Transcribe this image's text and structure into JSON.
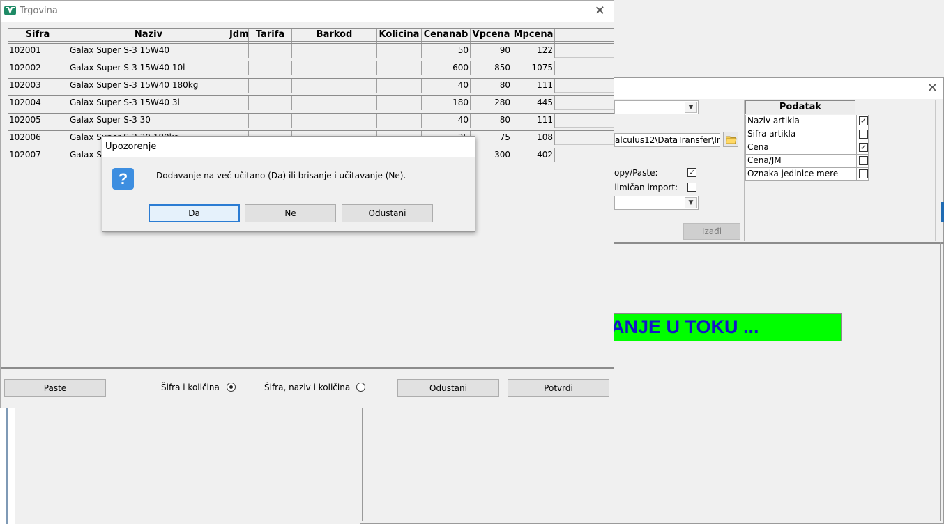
{
  "bg_window": {
    "path_value": "alculus12\\DataTransfer\\Im",
    "option_copy_paste_label": "opy/Paste:",
    "option_copy_paste_checked": true,
    "option_partial_import_label": "elimičan import:",
    "option_partial_import_checked": false,
    "exit_label": "Izađi",
    "podatak_header": "Podatak",
    "podatak_rows": [
      {
        "label": "Naziv artikla",
        "checked": true
      },
      {
        "label": "Sifra artikla",
        "checked": false
      },
      {
        "label": "Cena",
        "checked": true
      },
      {
        "label": "Cena/JM",
        "checked": false
      },
      {
        "label": "Oznaka jedinice mere",
        "checked": false
      }
    ],
    "progress_text": "ANJE U TOKU ...",
    "progress_color": "#00ff00",
    "progress_text_color": "#1515c8"
  },
  "main_window": {
    "title": "Trgovina",
    "columns": [
      "Sifra",
      "Naziv",
      "Jdm",
      "Tarifa",
      "Barkod",
      "Kolicina",
      "Cenanab",
      "Vpcena",
      "Mpcena"
    ],
    "rows": [
      [
        "102001",
        "Galax Super S-3 15W40",
        "",
        "",
        "",
        "",
        "50",
        "90",
        "122"
      ],
      [
        "102002",
        "Galax Super S-3 15W40 10l",
        "",
        "",
        "",
        "",
        "600",
        "850",
        "1075"
      ],
      [
        "102003",
        "Galax Super S-3 15W40 180kg",
        "",
        "",
        "",
        "",
        "40",
        "80",
        "111"
      ],
      [
        "102004",
        "Galax Super S-3 15W40 3l",
        "",
        "",
        "",
        "",
        "180",
        "280",
        "445"
      ],
      [
        "102005",
        "Galax Super S-3 30",
        "",
        "",
        "",
        "",
        "40",
        "80",
        "111"
      ],
      [
        "102006",
        "Galax Super S-3 30 180kg",
        "",
        "",
        "",
        "",
        "35",
        "75",
        "108"
      ],
      [
        "102007",
        "Galax Super S-3 30 5l",
        "",
        "",
        "",
        "",
        "200",
        "300",
        "402"
      ]
    ],
    "paste_label": "Paste",
    "radio_1_label": "Šifra i količina",
    "radio_1_selected": true,
    "radio_2_label": "Šifra, naziv i količina",
    "radio_2_selected": false,
    "cancel_label": "Odustani",
    "confirm_label": "Potvrdi"
  },
  "dialog": {
    "title": "Upozorenje",
    "icon": "question-icon",
    "message": "Dodavanje na već učitano (Da) ili brisanje i učitavanje (Ne).",
    "yes_label": "Da",
    "no_label": "Ne",
    "cancel_label": "Odustani"
  }
}
